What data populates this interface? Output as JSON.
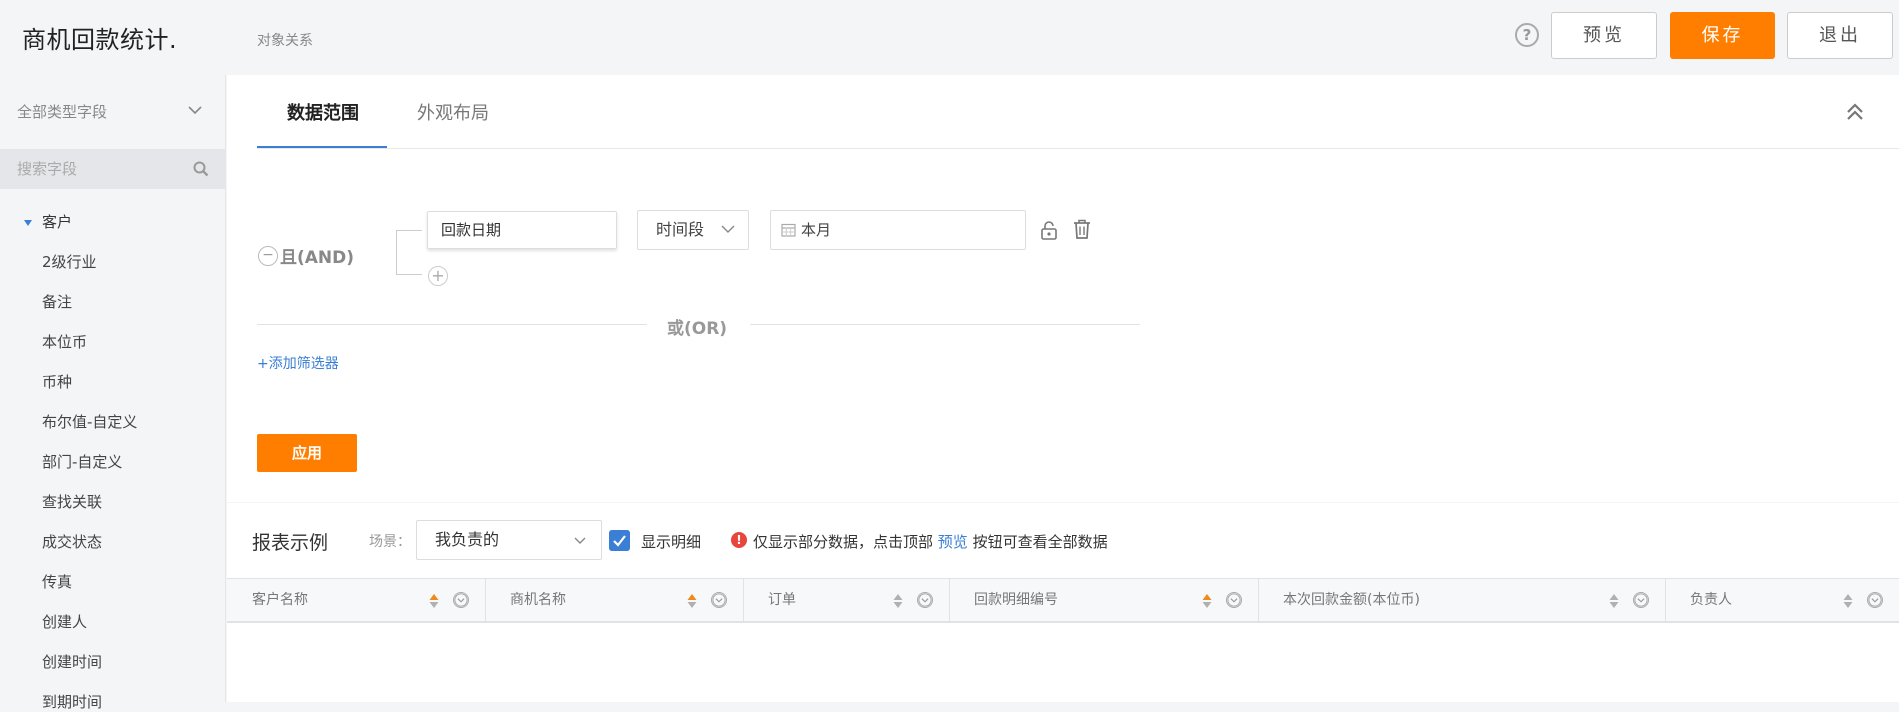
{
  "header": {
    "title": "商机回款统计.",
    "subtitle": "对象关系",
    "help_icon": "?",
    "preview_label": "预览",
    "save_label": "保存",
    "exit_label": "退出"
  },
  "sidebar": {
    "field_type": "全部类型字段",
    "search_placeholder": "搜索字段",
    "tree_root": "客户",
    "items": [
      "2级行业",
      "备注",
      "本位币",
      "币种",
      "布尔值-自定义",
      "部门-自定义",
      "查找关联",
      "成交状态",
      "传真",
      "创建人",
      "创建时间",
      "到期时间"
    ]
  },
  "tabs": {
    "range": "数据范围",
    "layout": "外观布局"
  },
  "filter": {
    "and_label": "且(AND)",
    "minus": "−",
    "plus": "+",
    "field": "回款日期",
    "operator": "时间段",
    "value": "本月",
    "or_label": "或(OR)",
    "add_filter": "+添加筛选器",
    "apply": "应用"
  },
  "report": {
    "title": "报表示例",
    "scene_label": "场景：",
    "scene_value": "我负责的",
    "show_detail": "显示明细",
    "warn_icon": "!",
    "notice_prefix": "仅显示部分数据，点击顶部",
    "notice_link": "预览",
    "notice_suffix": "按钮可查看全部数据",
    "columns": [
      {
        "label": "客户名称",
        "sort_active": true
      },
      {
        "label": "商机名称",
        "sort_active": true
      },
      {
        "label": "订单",
        "sort_active": false
      },
      {
        "label": "回款明细编号",
        "sort_active": true
      },
      {
        "label": "本次回款金额(本位币)",
        "sort_active": false
      },
      {
        "label": "负责人",
        "sort_active": false
      }
    ]
  },
  "colors": {
    "accent": "#3a7fd5",
    "primary_button": "#ff7e00",
    "sort_active": "#f08a1c",
    "warning": "#e8453c"
  }
}
